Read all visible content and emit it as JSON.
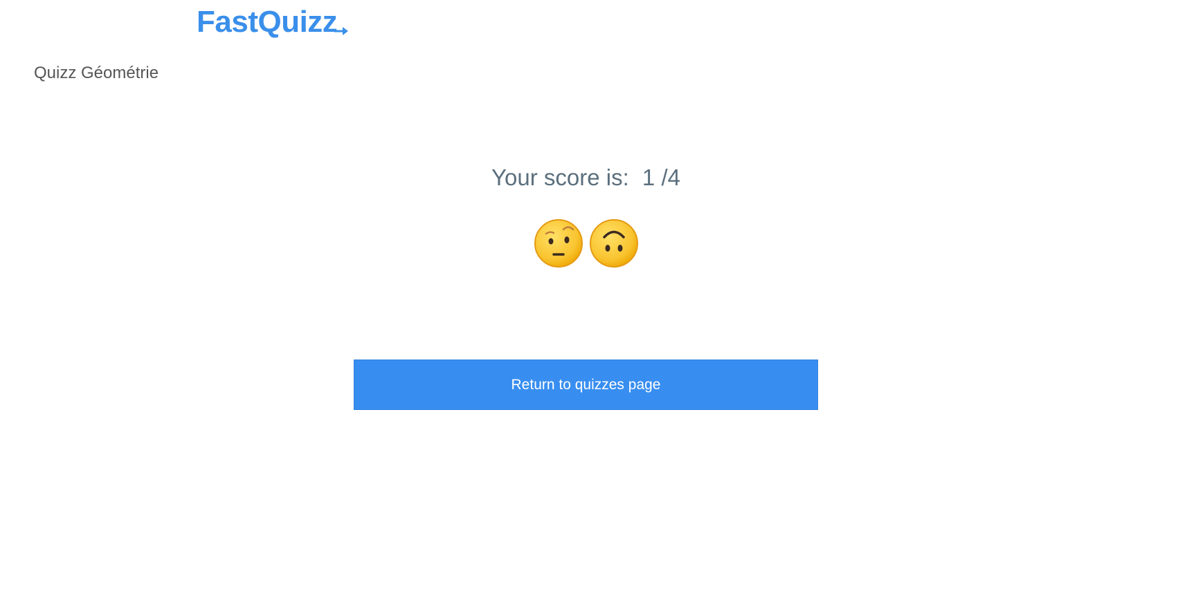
{
  "brand": {
    "name": "FastQuizz",
    "color": "#3a8fea"
  },
  "quiz": {
    "title": "Quizz Géométrie"
  },
  "result": {
    "score_label": "Your score is:",
    "score_value": "1 /4",
    "emojis": [
      "face-with-raised-eyebrow-icon",
      "upside-down-face-icon"
    ]
  },
  "actions": {
    "return_label": "Return to quizzes page",
    "button_color": "#388ef0"
  }
}
